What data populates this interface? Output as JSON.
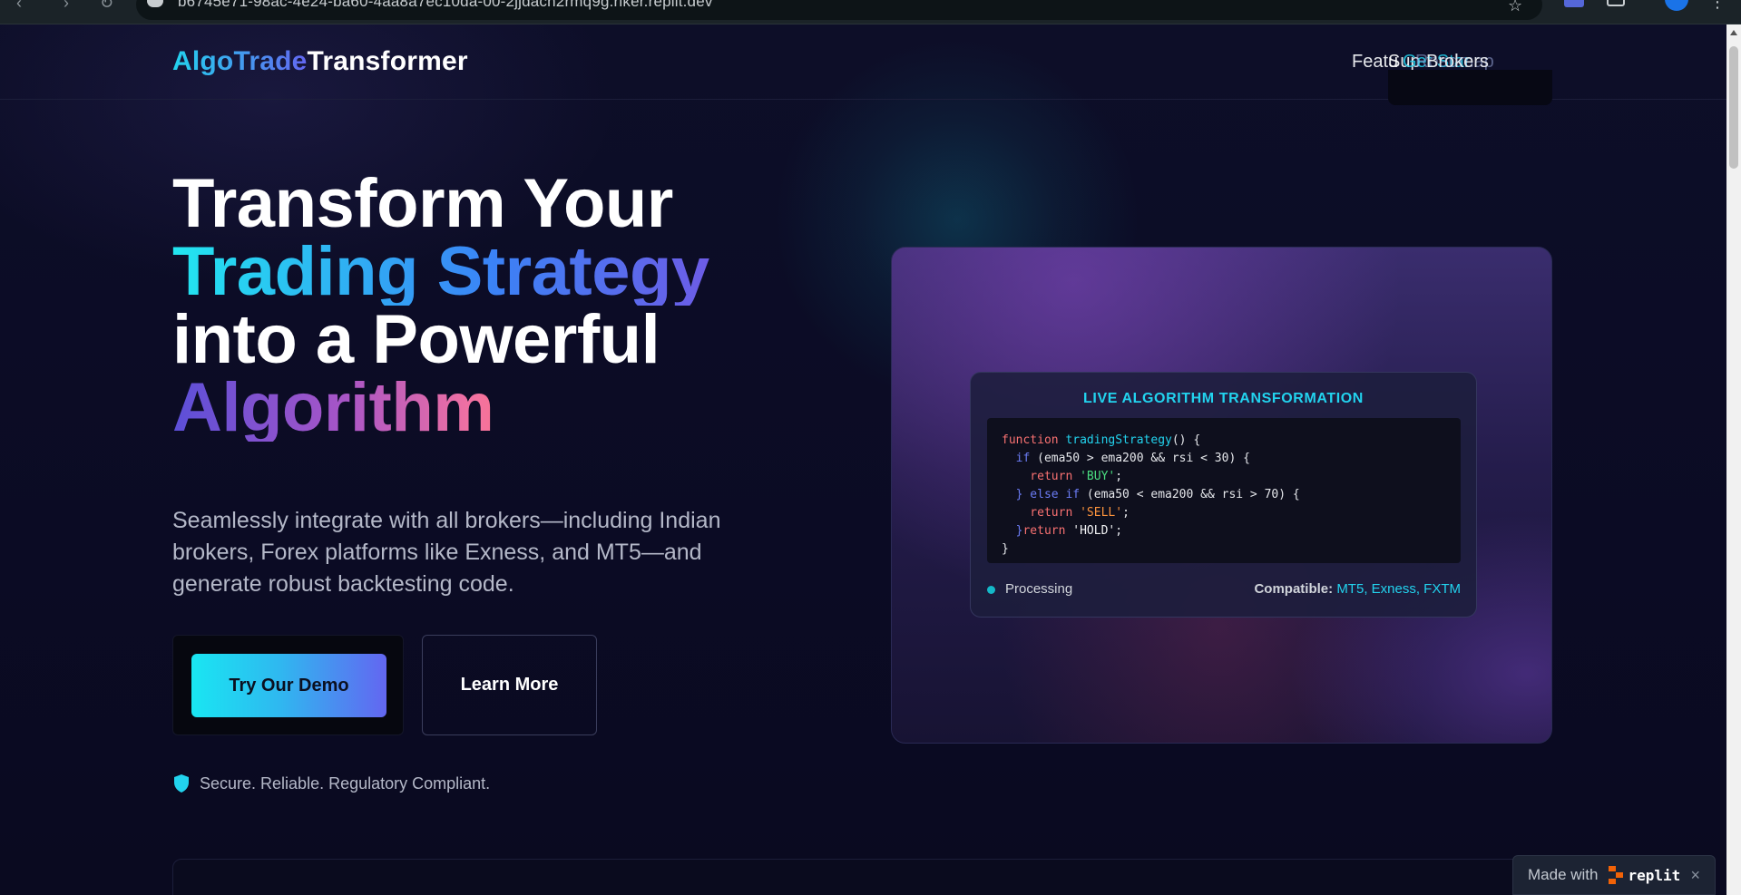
{
  "browser": {
    "url": "b6745e71-98ac-4e24-ba60-4aa8a7ec10da-00-2jjdach2rmq9g.riker.replit.dev"
  },
  "header": {
    "logo_part1": "AlgoTrade",
    "logo_part2": "Transformer",
    "nav_overlap": {
      "a": "Featu",
      "b": "Sup",
      "c": "Get Star",
      "d": "Roadmap",
      "e": "Brokers"
    }
  },
  "hero": {
    "title_line1": "Transform Your",
    "title_line2": "Trading Strategy",
    "title_line3": "into a Powerful",
    "title_line4": "Algorithm",
    "subtitle": "Seamlessly integrate with all brokers—including Indian brokers, Forex platforms like Exness, and MT5—and generate robust backtesting code.",
    "demo_button": "Try Our Demo",
    "learn_button": "Learn More",
    "trust_text": "Secure. Reliable. Regulatory Compliant."
  },
  "algo_panel": {
    "title": "LIVE ALGORITHM TRANSFORMATION",
    "code": {
      "l1_kw": "function ",
      "l1_fn": "tradingStrategy",
      "l1_rest": "() {",
      "l2_kw": "  if ",
      "l2_rest": "(ema50 > ema200 && rsi < 30) {",
      "l3_kw": "    return ",
      "l3_str": "'BUY'",
      "l3_end": ";",
      "l4_kw": "  } else if ",
      "l4_rest": "(ema50 < ema200 && rsi > 70) {",
      "l5_kw": "    return ",
      "l5_str": "'SELL'",
      "l5_end": ";",
      "l6_a": "  }",
      "l6_kw": "return ",
      "l6_str": "'HOLD'",
      "l6_end": ";",
      "l7": "}"
    },
    "status": "Processing",
    "compatible_label": "Compatible: ",
    "compatible_value": "MT5, Exness, FXTM"
  },
  "replit_badge": {
    "made_with": "Made with",
    "brand": "replit",
    "close": "×"
  },
  "colors": {
    "accent_cyan": "#22d3ee",
    "accent_indigo": "#6366f1",
    "background": "#0b0c22"
  }
}
